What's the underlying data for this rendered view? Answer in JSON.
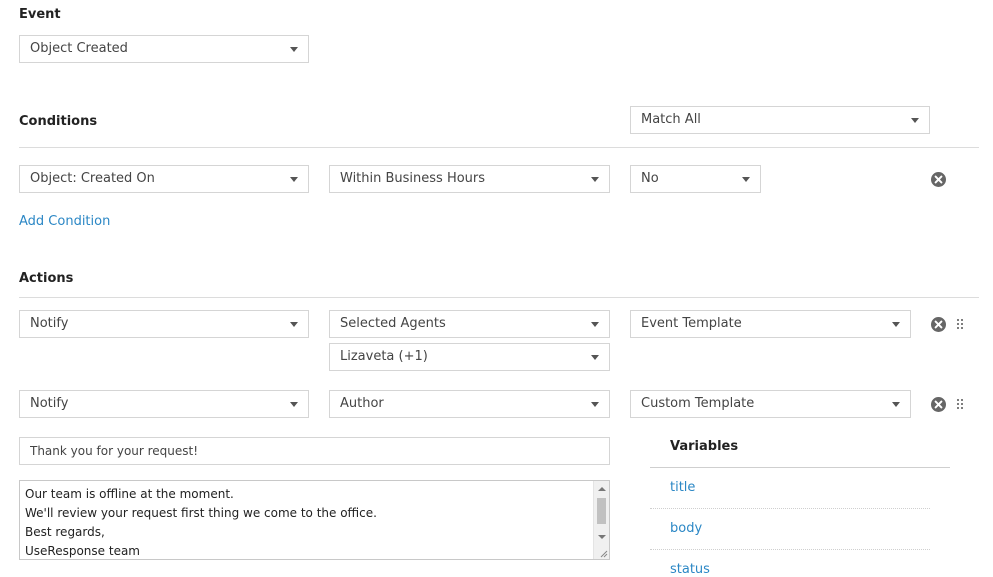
{
  "event": {
    "heading": "Event",
    "select": "Object Created"
  },
  "conditions": {
    "heading": "Conditions",
    "match_select": "Match All",
    "row": {
      "field": "Object: Created On",
      "operator": "Within Business Hours",
      "value": "No"
    },
    "add_label": "Add Condition"
  },
  "actions": {
    "heading": "Actions",
    "rows": [
      {
        "action": "Notify",
        "target": "Selected Agents",
        "target_detail": "Lizaveta (+1)",
        "template": "Event Template"
      },
      {
        "action": "Notify",
        "target": "Author",
        "template": "Custom Template"
      }
    ],
    "subject": "Thank you for your request!",
    "body_lines": [
      "Our team is offline at the moment.",
      "We'll review your request first thing we come to the office.",
      "Best regards,",
      "UseResponse team"
    ]
  },
  "variables": {
    "heading": "Variables",
    "items": [
      "title",
      "body",
      "status"
    ]
  },
  "icons": {
    "remove": "remove-circle-icon",
    "drag": "drag-handle-icon",
    "caret": "caret-down-icon"
  },
  "colors": {
    "link": "#2b87c5",
    "border": "#d5d5d5",
    "icon": "#666666"
  }
}
